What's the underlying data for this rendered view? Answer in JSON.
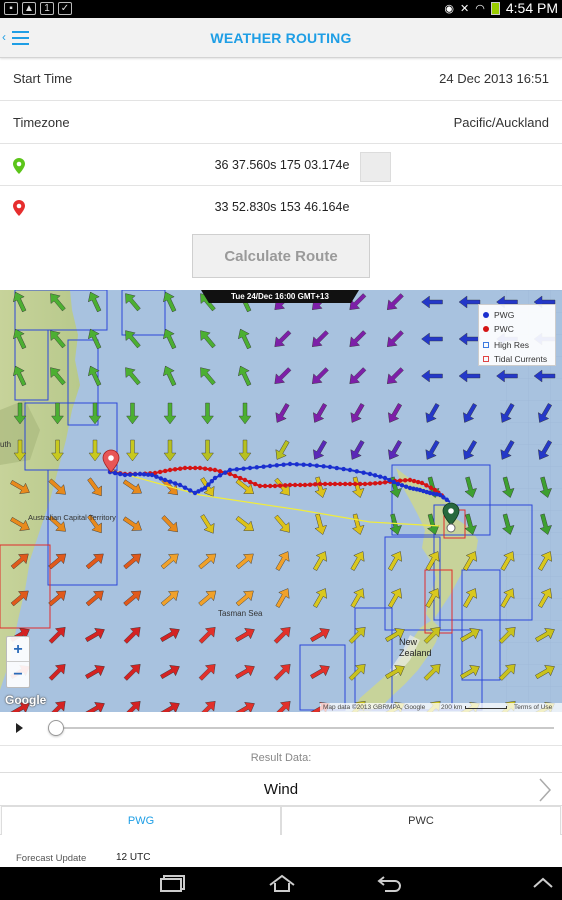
{
  "status_bar": {
    "time": "4:54 PM"
  },
  "action_bar": {
    "title": "WEATHER ROUTING",
    "back_glyph": "‹"
  },
  "settings": {
    "start_time_label": "Start Time",
    "start_time_value": "24 Dec 2013 16:51",
    "timezone_label": "Timezone",
    "timezone_value": "Pacific/Auckland",
    "start_point": "36 37.560s 175 03.174e",
    "end_point": "33 52.830s 153 46.164e",
    "calculate_label": "Calculate Route"
  },
  "map": {
    "time_label": "Tue 24/Dec 16:00 GMT+13",
    "legend": [
      {
        "label": "PWG",
        "color": "#1a2fcf",
        "kind": "dot"
      },
      {
        "label": "PWC",
        "color": "#d41414",
        "kind": "dot"
      },
      {
        "label": "High Res",
        "color": "#3b7ae0",
        "kind": "square"
      },
      {
        "label": "Tidal Currents",
        "color": "#e04444",
        "kind": "square"
      }
    ],
    "zoom_in": "+",
    "zoom_out": "−",
    "google": "Google",
    "attribution_data": "Map data ©2013 GBRMPA, Google",
    "scale_label": "200 km",
    "terms": "Terms of Use",
    "labels": {
      "capital": "Australian Capital Territory",
      "tasman": "Tasman Sea",
      "nz": "New Zealand",
      "south": "uth"
    }
  },
  "playback": {
    "position": 0
  },
  "results": {
    "section_label": "Result Data:",
    "selector_value": "Wind",
    "tab_pwg": "PWG",
    "tab_pwc": "PWC",
    "forecast_label": "Forecast Update",
    "forecast_value": "12 UTC"
  },
  "colors": {
    "accent": "#1e9ee5",
    "start_pin": "#5cc51a",
    "end_pin": "#e62e2e"
  }
}
